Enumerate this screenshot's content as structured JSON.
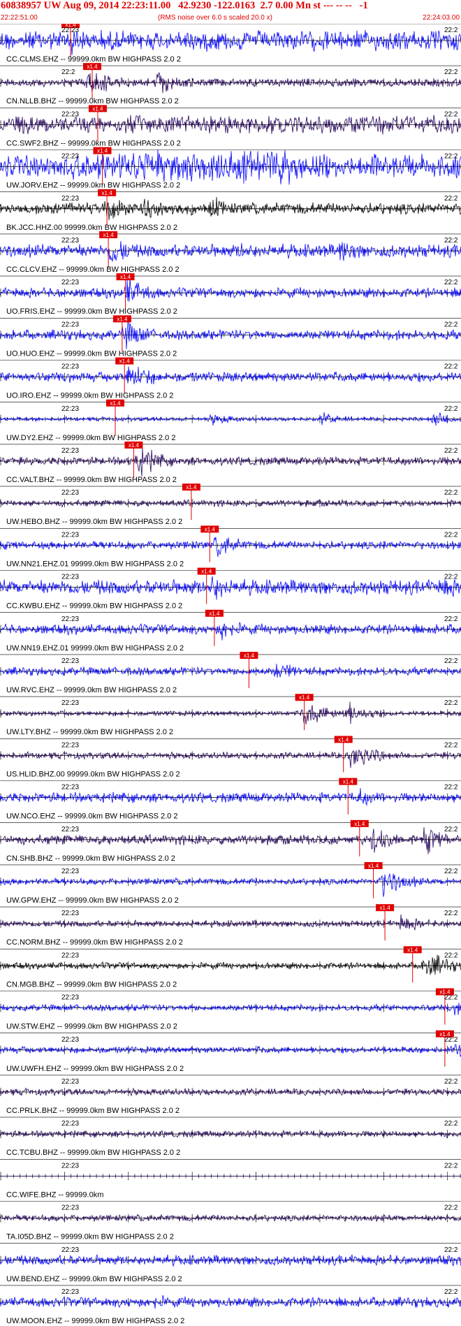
{
  "header": {
    "title": "60838957 UW Aug 09, 2014 22:23:11.00   42.9230 -122.0163  2.7 0.00 Mn st --- -- --   -1",
    "start_time": "22:22:51.00",
    "note": "(RMS noise over 6.0 s scaled 20.0 x)",
    "end_time": "22:24:03.00"
  },
  "colors": {
    "header_text": "#e00000",
    "pick": "#e00000",
    "blue": "#0000ff",
    "navy": "#23005a",
    "black": "#000000"
  },
  "chart_data": {
    "type": "line",
    "title": "",
    "time_range": [
      "22:22:51.00",
      "22:24:03.00"
    ],
    "pick_label": "x1.4",
    "traces": [
      {
        "label": "CC.CLMS.EHZ -- 99999.0km BW  HIGHPASS  2.0  2",
        "minute_left": "22:23",
        "minute_right": "22:2",
        "color": "#0000ff",
        "pick": 0.153,
        "amp": 0.6,
        "events": [
          [
            0.15,
            1.0
          ],
          [
            0.34,
            0.5
          ],
          [
            0.53,
            0.5
          ]
        ]
      },
      {
        "label": "CN.NLLB.BHZ -- 99999.0km BW  HIGHPASS  2.0  2",
        "minute_left": "22:2",
        "minute_right": "22:2",
        "color": "#23005a",
        "pick": 0.2,
        "amp": 0.25,
        "events": [
          [
            0.19,
            1.0
          ],
          [
            0.34,
            0.8
          ]
        ]
      },
      {
        "label": "CC.SWF2.BHZ -- 99999.0km BW  HIGHPASS  2.0  2",
        "minute_left": "22:23",
        "minute_right": "22:2",
        "color": "#23005a",
        "pick": 0.212,
        "amp": 0.55,
        "events": [
          [
            0.21,
            0.6
          ]
        ]
      },
      {
        "label": "UW.JORV.EHZ -- 99999.0km BW  HIGHPASS  2.0  2",
        "minute_left": "22:23",
        "minute_right": "22:2",
        "color": "#0000ff",
        "pick": 0.222,
        "amp": 0.7,
        "events": [
          [
            0.22,
            1.0
          ]
        ],
        "block": [
          0.24,
          0.66
        ]
      },
      {
        "label": "BK.JCC.HHZ.00 99999.0km BW  HIGHPASS  2.0  2",
        "minute_left": "22:23",
        "minute_right": "22:2",
        "color": "#000000",
        "pick": 0.232,
        "amp": 0.35,
        "events": [
          [
            0.23,
            1.0
          ],
          [
            0.31,
            0.8
          ],
          [
            0.46,
            0.8
          ]
        ]
      },
      {
        "label": "CC.CLCV.EHZ -- 99999.0km BW  HIGHPASS  2.0  2",
        "minute_left": "22:23",
        "minute_right": "22:2",
        "color": "#0000ff",
        "pick": 0.235,
        "amp": 0.4,
        "events": [
          [
            0.24,
            1.0
          ],
          [
            0.52,
            0.7
          ],
          [
            0.74,
            0.9
          ]
        ]
      },
      {
        "label": "UO.FRIS.EHZ -- 99999.0km BW  HIGHPASS  2.0  2",
        "minute_left": "22:23",
        "minute_right": "22:2",
        "color": "#0000ff",
        "pick": 0.272,
        "amp": 0.3,
        "events": [
          [
            0.275,
            1.0
          ]
        ]
      },
      {
        "label": "UO.HUO.EHZ -- 99999.0km BW  HIGHPASS  2.0  2",
        "minute_left": "22:23",
        "minute_right": "22:2",
        "color": "#0000ff",
        "pick": 0.265,
        "amp": 0.3,
        "events": [
          [
            0.27,
            1.0
          ]
        ]
      },
      {
        "label": "UO.IRO.EHZ -- 99999.0km BW  HIGHPASS  2.0  2",
        "minute_left": "22:23",
        "minute_right": "22:2",
        "color": "#0000ff",
        "pick": 0.27,
        "amp": 0.3,
        "events": [
          [
            0.28,
            1.0
          ]
        ]
      },
      {
        "label": "UW.DY2.EHZ -- 99999.0km BW  HIGHPASS  2.0  2",
        "minute_left": "22:23",
        "minute_right": "22:2",
        "color": "#0000ff",
        "pick": 0.25,
        "amp": 0.12,
        "events": [
          [
            0.46,
            0.4
          ],
          [
            0.7,
            0.4
          ],
          [
            0.94,
            0.5
          ]
        ]
      },
      {
        "label": "CC.VALT.BHZ -- 99999.0km BW  HIGHPASS  2.0  2",
        "minute_left": "22:23",
        "minute_right": "22:2",
        "color": "#23005a",
        "pick": 0.29,
        "amp": 0.25,
        "events": [
          [
            0.3,
            1.0
          ]
        ]
      },
      {
        "label": "UW.HEBO.BHZ -- 99999.0km BW  HIGHPASS  2.0  2",
        "minute_left": "22:23",
        "minute_right": "22:2",
        "color": "#23005a",
        "pick": 0.415,
        "amp": 0.2,
        "events": []
      },
      {
        "label": "UW.NN21.EHZ.01 99999.0km BW  HIGHPASS  2.0  2",
        "minute_left": "22:23",
        "minute_right": "22:2",
        "color": "#0000ff",
        "pick": 0.455,
        "amp": 0.25,
        "events": [
          [
            0.47,
            0.8
          ]
        ]
      },
      {
        "label": "CC.KWBU.EHZ -- 99999.0km BW  HIGHPASS  2.0  2",
        "minute_left": "22:23",
        "minute_right": "22:2",
        "color": "#0000ff",
        "pick": 0.448,
        "amp": 0.45,
        "events": [
          [
            0.46,
            1.0
          ],
          [
            0.96,
            0.8
          ]
        ]
      },
      {
        "label": "UW.NN19.EHZ.01 99999.0km BW  HIGHPASS  2.0  2",
        "minute_left": "22:23",
        "minute_right": "22:2",
        "color": "#0000ff",
        "pick": 0.465,
        "amp": 0.3,
        "events": [
          [
            0.48,
            0.8
          ]
        ]
      },
      {
        "label": "UW.RVC.EHZ -- 99999.0km BW  HIGHPASS  2.0  2",
        "minute_left": "22:23",
        "minute_right": "22:2",
        "color": "#0000ff",
        "pick": 0.54,
        "amp": 0.25,
        "events": [
          [
            0.6,
            0.7
          ]
        ]
      },
      {
        "label": "UW.LTY.BHZ -- 99999.0km BW  HIGHPASS  2.0  2",
        "minute_left": "22:23",
        "minute_right": "22:2",
        "color": "#23005a",
        "pick": 0.66,
        "amp": 0.15,
        "events": [
          [
            0.66,
            0.9
          ],
          [
            0.75,
            0.8
          ]
        ]
      },
      {
        "label": "US.HLID.BHZ.00 99999.0km BW  HIGHPASS  2.0  2",
        "minute_left": "22:23",
        "minute_right": "22:2",
        "color": "#23005a",
        "pick": 0.745,
        "amp": 0.2,
        "events": [
          [
            0.76,
            1.0
          ]
        ]
      },
      {
        "label": "UW.NCO.EHZ -- 99999.0km BW  HIGHPASS  2.0  2",
        "minute_left": "22:23",
        "minute_right": "22:2",
        "color": "#0000ff",
        "pick": 0.755,
        "amp": 0.3,
        "events": [
          [
            0.78,
            0.6
          ]
        ]
      },
      {
        "label": "CN.SHB.BHZ -- 99999.0km BW  HIGHPASS  2.0  2",
        "minute_left": "22:23",
        "minute_right": "22:2",
        "color": "#23005a",
        "pick": 0.78,
        "amp": 0.3,
        "events": [
          [
            0.81,
            1.0
          ],
          [
            0.92,
            0.9
          ]
        ]
      },
      {
        "label": "UW.GPW.EHZ -- 99999.0km BW  HIGHPASS  2.0  2",
        "minute_left": "22:23",
        "minute_right": "22:2",
        "color": "#0000ff",
        "pick": 0.81,
        "amp": 0.2,
        "events": [
          [
            0.83,
            1.0
          ]
        ]
      },
      {
        "label": "CC.NORM.BHZ -- 99999.0km BW  HIGHPASS  2.0  2",
        "minute_left": "22:23",
        "minute_right": "22:2",
        "color": "#23005a",
        "pick": 0.835,
        "amp": 0.2,
        "events": [
          [
            0.87,
            0.6
          ]
        ]
      },
      {
        "label": "CN.MGB.BHZ -- 99999.0km BW  HIGHPASS  2.0  2",
        "minute_left": "22:23",
        "minute_right": "22:2",
        "color": "#000000",
        "pick": 0.895,
        "amp": 0.2,
        "events": [
          [
            0.92,
            1.0
          ]
        ]
      },
      {
        "label": "UW.STW.EHZ -- 99999.0km BW  HIGHPASS  2.0  2",
        "minute_left": "22:23",
        "minute_right": "22:2",
        "color": "#0000ff",
        "pick": 0.965,
        "amp": 0.2,
        "events": [
          [
            0.99,
            0.6
          ]
        ]
      },
      {
        "label": "UW.UWFH.EHZ -- 99999.0km BW  HIGHPASS  2.0  2",
        "minute_left": "22:23",
        "minute_right": "22:2",
        "color": "#0000ff",
        "pick": 0.965,
        "amp": 0.2,
        "events": [
          [
            0.99,
            0.6
          ]
        ]
      },
      {
        "label": "CC.PRLK.BHZ -- 99999.0km BW  HIGHPASS  2.0  2",
        "minute_left": "22:23",
        "minute_right": "22:2",
        "color": "#23005a",
        "pick": null,
        "amp": 0.2,
        "events": []
      },
      {
        "label": "CC.TCBU.BHZ -- 99999.0km BW  HIGHPASS  2.0  2",
        "minute_left": "22:23",
        "minute_right": "22:2",
        "color": "#23005a",
        "pick": null,
        "amp": 0.2,
        "events": []
      },
      {
        "label": "CC.WIFE.BHZ -- 99999.0km",
        "minute_left": "22:23",
        "minute_right": "22:2",
        "color": "#23005a",
        "pick": null,
        "amp": 0.0,
        "events": []
      },
      {
        "label": "TA.I05D.BHZ -- 99999.0km BW  HIGHPASS  2.0  2",
        "minute_left": "22:23",
        "minute_right": "22:2",
        "color": "#23005a",
        "pick": null,
        "amp": 0.2,
        "events": []
      },
      {
        "label": "UW.BEND.EHZ -- 99999.0km BW  HIGHPASS  2.0  2",
        "minute_left": "22:23",
        "minute_right": "22:2",
        "color": "#0000ff",
        "pick": null,
        "amp": 0.3,
        "events": []
      },
      {
        "label": "UW.MOON.EHZ -- 99999.0km BW  HIGHPASS  2.0  2",
        "minute_left": "22:23",
        "minute_right": "22:2",
        "color": "#0000ff",
        "pick": null,
        "amp": 0.3,
        "events": [
          [
            0.33,
            0.6
          ]
        ]
      }
    ]
  }
}
